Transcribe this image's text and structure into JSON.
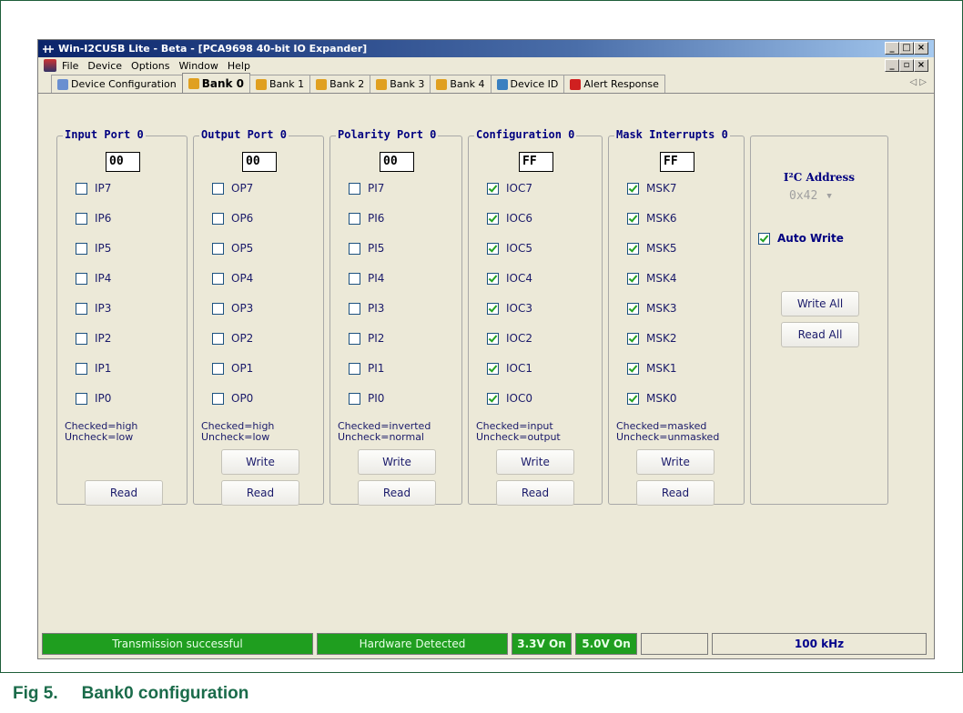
{
  "window": {
    "title": "Win-I2CUSB Lite - Beta - [PCA9698 40-bit IO Expander]"
  },
  "menu": [
    "File",
    "Device",
    "Options",
    "Window",
    "Help"
  ],
  "tabs": [
    {
      "label": "Device Configuration",
      "icon": "device-config-icon",
      "active": false
    },
    {
      "label": "Bank 0",
      "icon": "bank-icon",
      "active": true
    },
    {
      "label": "Bank 1",
      "icon": "bank-icon",
      "active": false
    },
    {
      "label": "Bank 2",
      "icon": "bank-icon",
      "active": false
    },
    {
      "label": "Bank 3",
      "icon": "bank-icon",
      "active": false
    },
    {
      "label": "Bank 4",
      "icon": "bank-icon",
      "active": false
    },
    {
      "label": "Device ID",
      "icon": "device-id-icon",
      "active": false
    },
    {
      "label": "Alert Response",
      "icon": "alert-icon",
      "active": false
    }
  ],
  "groups": [
    {
      "title": "Input Port 0",
      "value": "00",
      "bits": [
        {
          "label": "IP7",
          "checked": false
        },
        {
          "label": "IP6",
          "checked": false
        },
        {
          "label": "IP5",
          "checked": false
        },
        {
          "label": "IP4",
          "checked": false
        },
        {
          "label": "IP3",
          "checked": false
        },
        {
          "label": "IP2",
          "checked": false
        },
        {
          "label": "IP1",
          "checked": false
        },
        {
          "label": "IP0",
          "checked": false
        }
      ],
      "hint": "Checked=high\nUncheck=low",
      "write_label": null,
      "read_label": "Read"
    },
    {
      "title": "Output Port 0",
      "value": "00",
      "bits": [
        {
          "label": "OP7",
          "checked": false
        },
        {
          "label": "OP6",
          "checked": false
        },
        {
          "label": "OP5",
          "checked": false
        },
        {
          "label": "OP4",
          "checked": false
        },
        {
          "label": "OP3",
          "checked": false
        },
        {
          "label": "OP2",
          "checked": false
        },
        {
          "label": "OP1",
          "checked": false
        },
        {
          "label": "OP0",
          "checked": false
        }
      ],
      "hint": "Checked=high\nUncheck=low",
      "write_label": "Write",
      "read_label": "Read"
    },
    {
      "title": "Polarity Port 0",
      "value": "00",
      "bits": [
        {
          "label": "PI7",
          "checked": false
        },
        {
          "label": "PI6",
          "checked": false
        },
        {
          "label": "PI5",
          "checked": false
        },
        {
          "label": "PI4",
          "checked": false
        },
        {
          "label": "PI3",
          "checked": false
        },
        {
          "label": "PI2",
          "checked": false
        },
        {
          "label": "PI1",
          "checked": false
        },
        {
          "label": "PI0",
          "checked": false
        }
      ],
      "hint": "Checked=inverted\nUncheck=normal",
      "write_label": "Write",
      "read_label": "Read"
    },
    {
      "title": "Configuration 0",
      "value": "FF",
      "bits": [
        {
          "label": "IOC7",
          "checked": true
        },
        {
          "label": "IOC6",
          "checked": true
        },
        {
          "label": "IOC5",
          "checked": true
        },
        {
          "label": "IOC4",
          "checked": true
        },
        {
          "label": "IOC3",
          "checked": true
        },
        {
          "label": "IOC2",
          "checked": true
        },
        {
          "label": "IOC1",
          "checked": true
        },
        {
          "label": "IOC0",
          "checked": true
        }
      ],
      "hint": "Checked=input\nUncheck=output",
      "write_label": "Write",
      "read_label": "Read"
    },
    {
      "title": "Mask Interrupts 0",
      "value": "FF",
      "bits": [
        {
          "label": "MSK7",
          "checked": true
        },
        {
          "label": "MSK6",
          "checked": true
        },
        {
          "label": "MSK5",
          "checked": true
        },
        {
          "label": "MSK4",
          "checked": true
        },
        {
          "label": "MSK3",
          "checked": true
        },
        {
          "label": "MSK2",
          "checked": true
        },
        {
          "label": "MSK1",
          "checked": true
        },
        {
          "label": "MSK0",
          "checked": true
        }
      ],
      "hint": "Checked=masked\nUncheck=unmasked",
      "write_label": "Write",
      "read_label": "Read"
    }
  ],
  "side": {
    "address_label": "I²C Address",
    "address_value": "0x42",
    "auto_write_label": "Auto Write",
    "auto_write_checked": true,
    "write_all_label": "Write All",
    "read_all_label": "Read All"
  },
  "status": {
    "transmission": "Transmission successful",
    "hardware": "Hardware Detected",
    "v33": "3.3V On",
    "v50": "5.0V On",
    "empty": "",
    "speed": "100 kHz"
  },
  "caption": {
    "number": "Fig 5.",
    "text": "Bank0 configuration"
  },
  "colors": {
    "status_green": "#1f9e1f",
    "title_text": "#000080",
    "caption": "#1a6b4a"
  }
}
